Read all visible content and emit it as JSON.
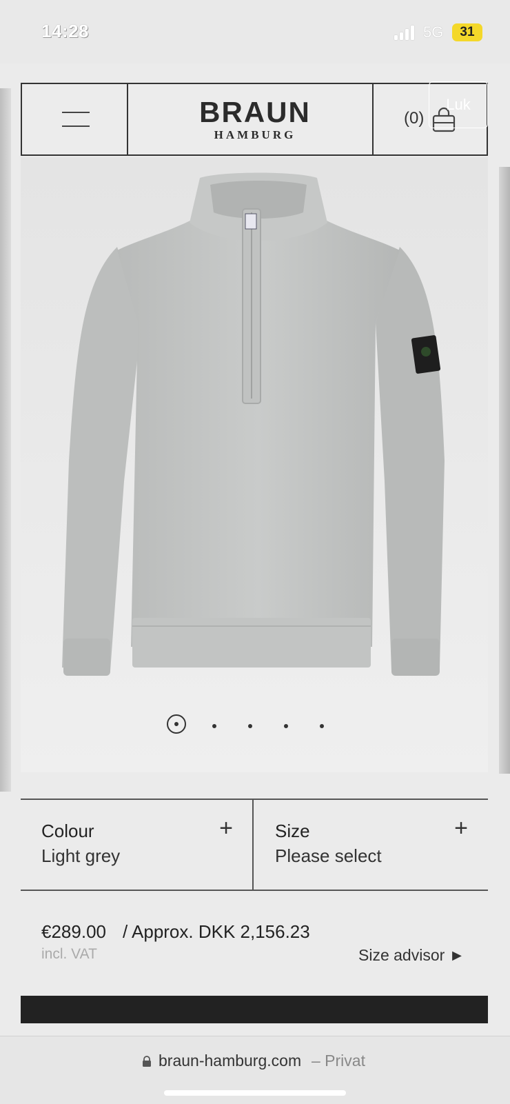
{
  "status_bar": {
    "time": "14:28",
    "network": "5G",
    "battery": "31"
  },
  "header": {
    "brand": "BRAUN",
    "brand_sub": "HAMBURG",
    "cart_count": "(0)",
    "close_label": "Luk"
  },
  "gallery": {
    "image_count": 5,
    "active_index": 0
  },
  "options": {
    "colour_title": "Colour",
    "colour_value": "Light grey",
    "size_title": "Size",
    "size_value": "Please select"
  },
  "pricing": {
    "price": "€289.00",
    "approx": "/ Approx. DKK 2,156.23",
    "vat": "incl. VAT",
    "size_advisor": "Size advisor ►"
  },
  "browser": {
    "url": "braun-hamburg.com",
    "mode": "– Privat"
  },
  "colors": {
    "background": "#ebebeb",
    "accent_dark": "#222222",
    "battery": "#f4d82a",
    "product": "#c4c6c5"
  }
}
